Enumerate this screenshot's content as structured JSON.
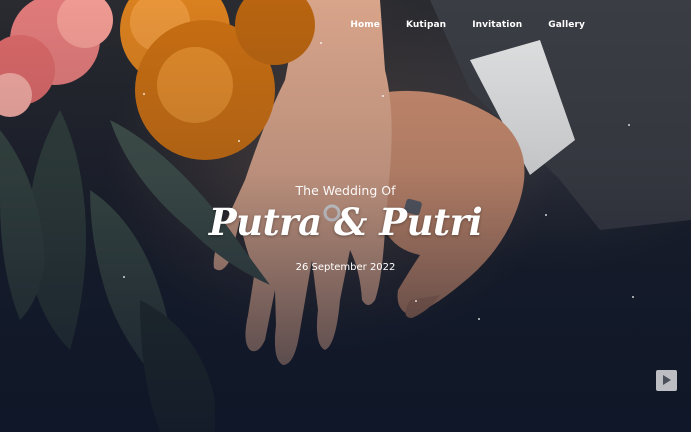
{
  "nav": {
    "items": [
      {
        "label": "Home"
      },
      {
        "label": "Kutipan"
      },
      {
        "label": "Invitation"
      },
      {
        "label": "Gallery"
      }
    ]
  },
  "hero": {
    "subtitle": "The Wedding Of",
    "couple": "Putra & Putri",
    "date": "26 September 2022"
  },
  "controls": {
    "play_icon": "play-icon"
  },
  "colors": {
    "text": "#ffffff",
    "overlay": "#0f1624",
    "flower_orange": "#d9801f",
    "flower_pink": "#e07a7a",
    "leaf": "#3f4f4a"
  }
}
